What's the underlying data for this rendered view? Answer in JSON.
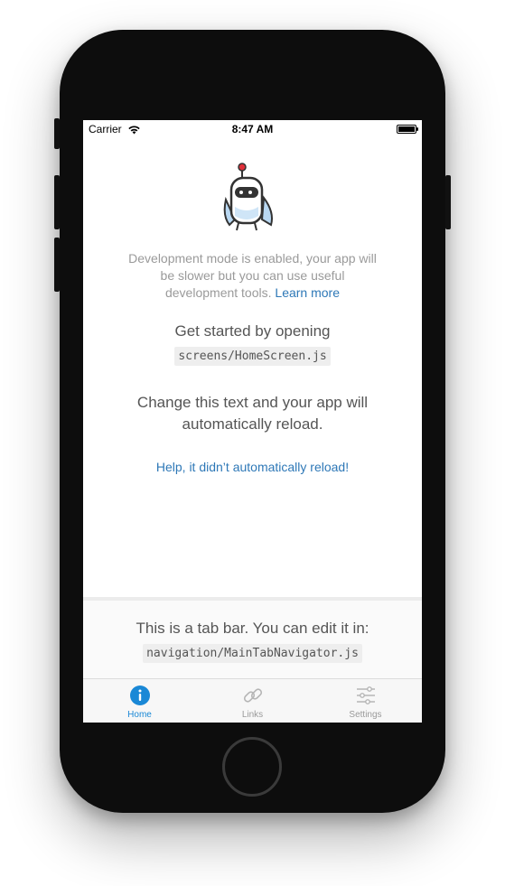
{
  "status_bar": {
    "carrier": "Carrier",
    "time": "8:47 AM",
    "wifi_icon": "wifi-icon",
    "battery_icon": "battery-icon"
  },
  "home": {
    "dev_mode_text": "Development mode is enabled, your app will be slower but you can use useful development tools.",
    "learn_more": "Learn more",
    "get_started": "Get started by opening",
    "file_path": "screens/HomeScreen.js",
    "change_text": "Change this text and your app will automatically reload.",
    "help_link": "Help, it didn’t automatically reload!"
  },
  "tab_info": {
    "text": "This is a tab bar. You can edit it in:",
    "file_path": "navigation/MainTabNavigator.js"
  },
  "tabbar": {
    "tabs": [
      {
        "label": "Home",
        "icon": "info-icon",
        "active": true
      },
      {
        "label": "Links",
        "icon": "link-icon",
        "active": false
      },
      {
        "label": "Settings",
        "icon": "options-icon",
        "active": false
      }
    ]
  },
  "colors": {
    "link": "#2e78b7",
    "active_tab": "#1a88d6",
    "inactive_tab": "#9a9a9a",
    "text": "#555555"
  }
}
